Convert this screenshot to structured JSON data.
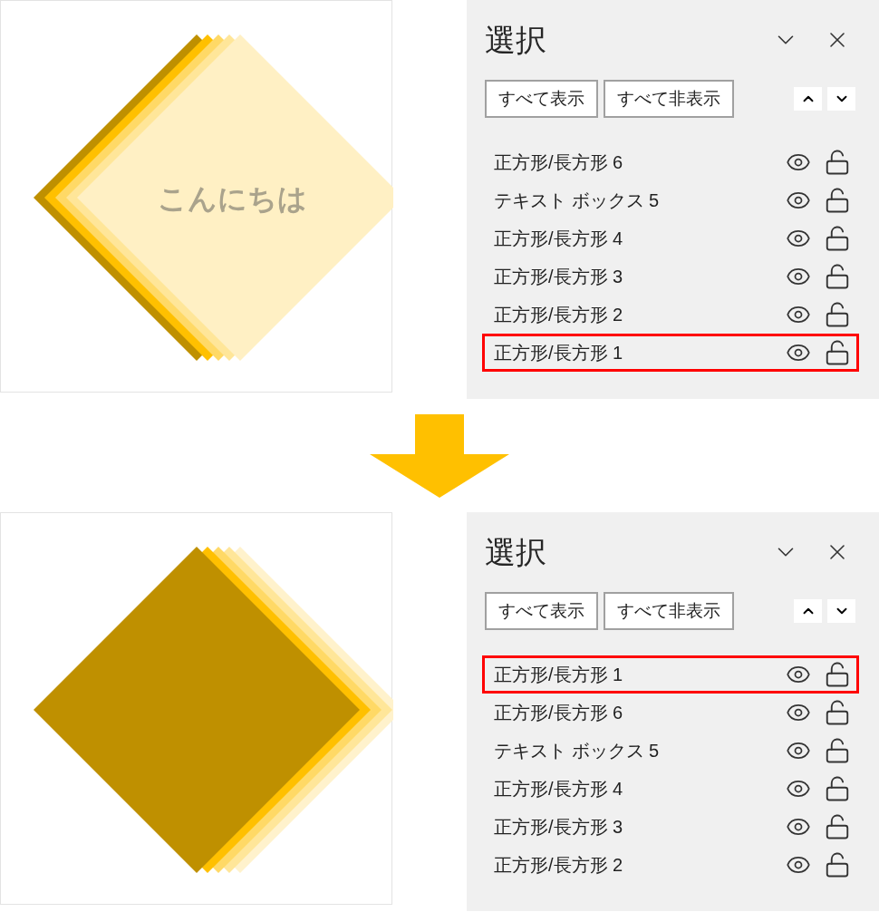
{
  "steps": [
    {
      "canvas": {
        "kind": "cascade",
        "text": "こんにちは"
      },
      "pane": {
        "title": "選択",
        "buttons": [
          "すべて表示",
          "すべて非表示"
        ],
        "items": [
          {
            "label": "正方形/長方形 6",
            "selected": false
          },
          {
            "label": "テキスト ボックス 5",
            "selected": false
          },
          {
            "label": "正方形/長方形 4",
            "selected": false
          },
          {
            "label": "正方形/長方形 3",
            "selected": false
          },
          {
            "label": "正方形/長方形 2",
            "selected": false
          },
          {
            "label": "正方形/長方形 1",
            "selected": true
          }
        ]
      }
    },
    {
      "canvas": {
        "kind": "raised"
      },
      "pane": {
        "title": "選択",
        "buttons": [
          "すべて表示",
          "すべて非表示"
        ],
        "items": [
          {
            "label": "正方形/長方形 1",
            "selected": true
          },
          {
            "label": "正方形/長方形 6",
            "selected": false
          },
          {
            "label": "テキスト ボックス 5",
            "selected": false
          },
          {
            "label": "正方形/長方形 4",
            "selected": false
          },
          {
            "label": "正方形/長方形 3",
            "selected": false
          },
          {
            "label": "正方形/長方形 2",
            "selected": false
          }
        ]
      }
    }
  ]
}
